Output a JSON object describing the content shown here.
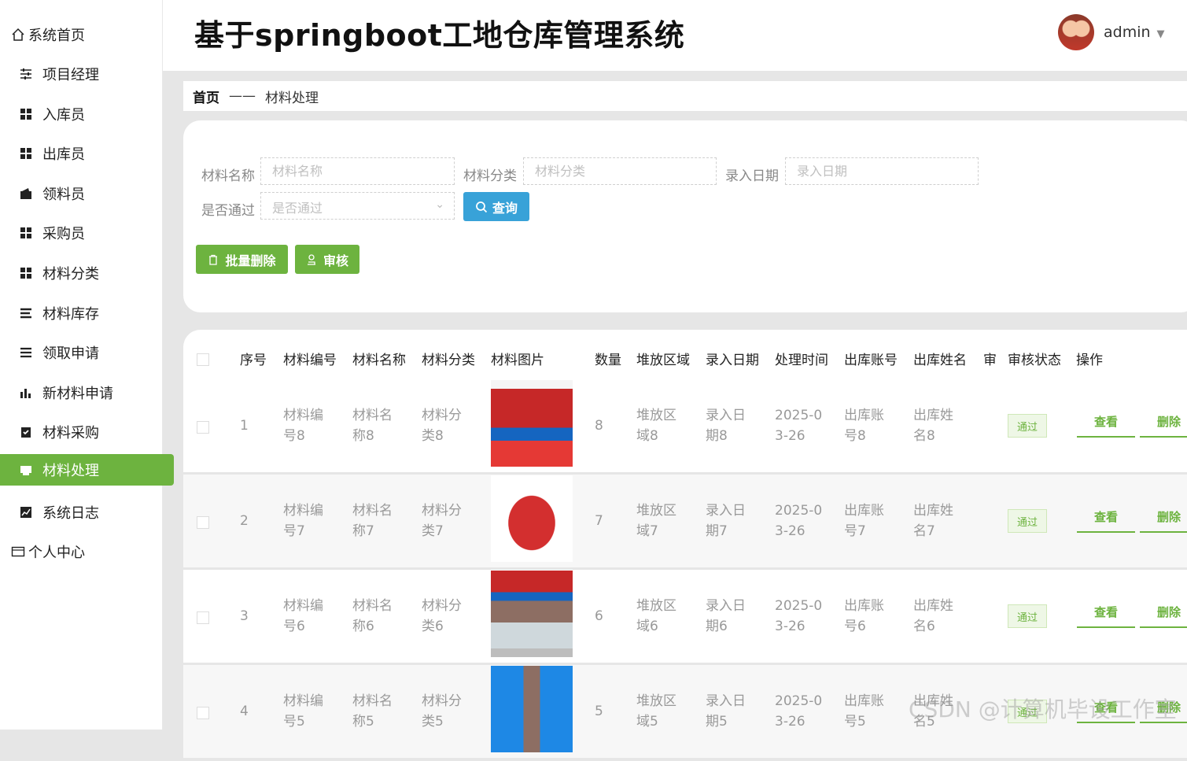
{
  "app": {
    "title": "基于springboot工地仓库管理系统",
    "user": "admin"
  },
  "sidebar": {
    "items": [
      {
        "label": "系统首页",
        "icon": "home-icon"
      },
      {
        "label": "项目经理",
        "icon": "sliders-icon"
      },
      {
        "label": "入库员",
        "icon": "grid-icon"
      },
      {
        "label": "出库员",
        "icon": "grid-icon"
      },
      {
        "label": "领料员",
        "icon": "wallet-icon"
      },
      {
        "label": "采购员",
        "icon": "grid-icon"
      },
      {
        "label": "材料分类",
        "icon": "grid-icon"
      },
      {
        "label": "材料库存",
        "icon": "list-icon"
      },
      {
        "label": "领取申请",
        "icon": "list-icon"
      },
      {
        "label": "新材料申请",
        "icon": "bar-chart-icon"
      },
      {
        "label": "材料采购",
        "icon": "clipboard-check-icon"
      },
      {
        "label": "材料处理",
        "icon": "printer-icon",
        "active": true
      },
      {
        "label": "系统日志",
        "icon": "line-chart-icon"
      },
      {
        "label": "个人中心",
        "icon": "wallet-outline-icon"
      }
    ]
  },
  "breadcrumb": {
    "home": "首页",
    "separator": "——",
    "current": "材料处理"
  },
  "search": {
    "name_label": "材料名称",
    "name_placeholder": "材料名称",
    "category_label": "材料分类",
    "category_placeholder": "材料分类",
    "date_label": "录入日期",
    "date_placeholder": "录入日期",
    "passed_label": "是否通过",
    "passed_placeholder": "是否通过",
    "query_button": "查询",
    "batch_delete_button": "批量删除",
    "review_button": "审核"
  },
  "table": {
    "headers": [
      "序号",
      "材料编号",
      "材料名称",
      "材料分类",
      "材料图片",
      "数量",
      "堆放区域",
      "录入日期",
      "处理时间",
      "出库账号",
      "出库姓名",
      "审",
      "审核状态",
      "操作"
    ],
    "rows": [
      {
        "index": "1",
        "code": [
          "材料编",
          "号8"
        ],
        "name": [
          "材料名",
          "称8"
        ],
        "category": [
          "材料分",
          "类8"
        ],
        "qty": "8",
        "area": [
          "堆放区",
          "域8"
        ],
        "date": [
          "录入日",
          "期8"
        ],
        "time": [
          "2025-0",
          "3-26"
        ],
        "account": [
          "出库账",
          "号8"
        ],
        "person": [
          "出库姓",
          "名8"
        ],
        "status": "通过",
        "view": "查看",
        "delete": "删除"
      },
      {
        "index": "2",
        "code": [
          "材料编",
          "号7"
        ],
        "name": [
          "材料名",
          "称7"
        ],
        "category": [
          "材料分",
          "类7"
        ],
        "qty": "7",
        "area": [
          "堆放区",
          "域7"
        ],
        "date": [
          "录入日",
          "期7"
        ],
        "time": [
          "2025-0",
          "3-26"
        ],
        "account": [
          "出库账",
          "号7"
        ],
        "person": [
          "出库姓",
          "名7"
        ],
        "status": "通过",
        "view": "查看",
        "delete": "删除"
      },
      {
        "index": "3",
        "code": [
          "材料编",
          "号6"
        ],
        "name": [
          "材料名",
          "称6"
        ],
        "category": [
          "材料分",
          "类6"
        ],
        "qty": "6",
        "area": [
          "堆放区",
          "域6"
        ],
        "date": [
          "录入日",
          "期6"
        ],
        "time": [
          "2025-0",
          "3-26"
        ],
        "account": [
          "出库账",
          "号6"
        ],
        "person": [
          "出库姓",
          "名6"
        ],
        "status": "通过",
        "view": "查看",
        "delete": "删除"
      },
      {
        "index": "4",
        "code": [
          "材料编",
          "号5"
        ],
        "name": [
          "材料名",
          "称5"
        ],
        "category": [
          "材料分",
          "类5"
        ],
        "qty": "5",
        "area": [
          "堆放区",
          "域5"
        ],
        "date": [
          "录入日",
          "期5"
        ],
        "time": [
          "2025-0",
          "3-26"
        ],
        "account": [
          "出库账",
          "号5"
        ],
        "person": [
          "出库姓",
          "名5"
        ],
        "status": "通过",
        "view": "查看",
        "delete": "删除"
      }
    ]
  },
  "watermark": "CSDN @计算机毕设工作室",
  "colors": {
    "accent": "#6db33f",
    "query": "#38a2d8"
  }
}
